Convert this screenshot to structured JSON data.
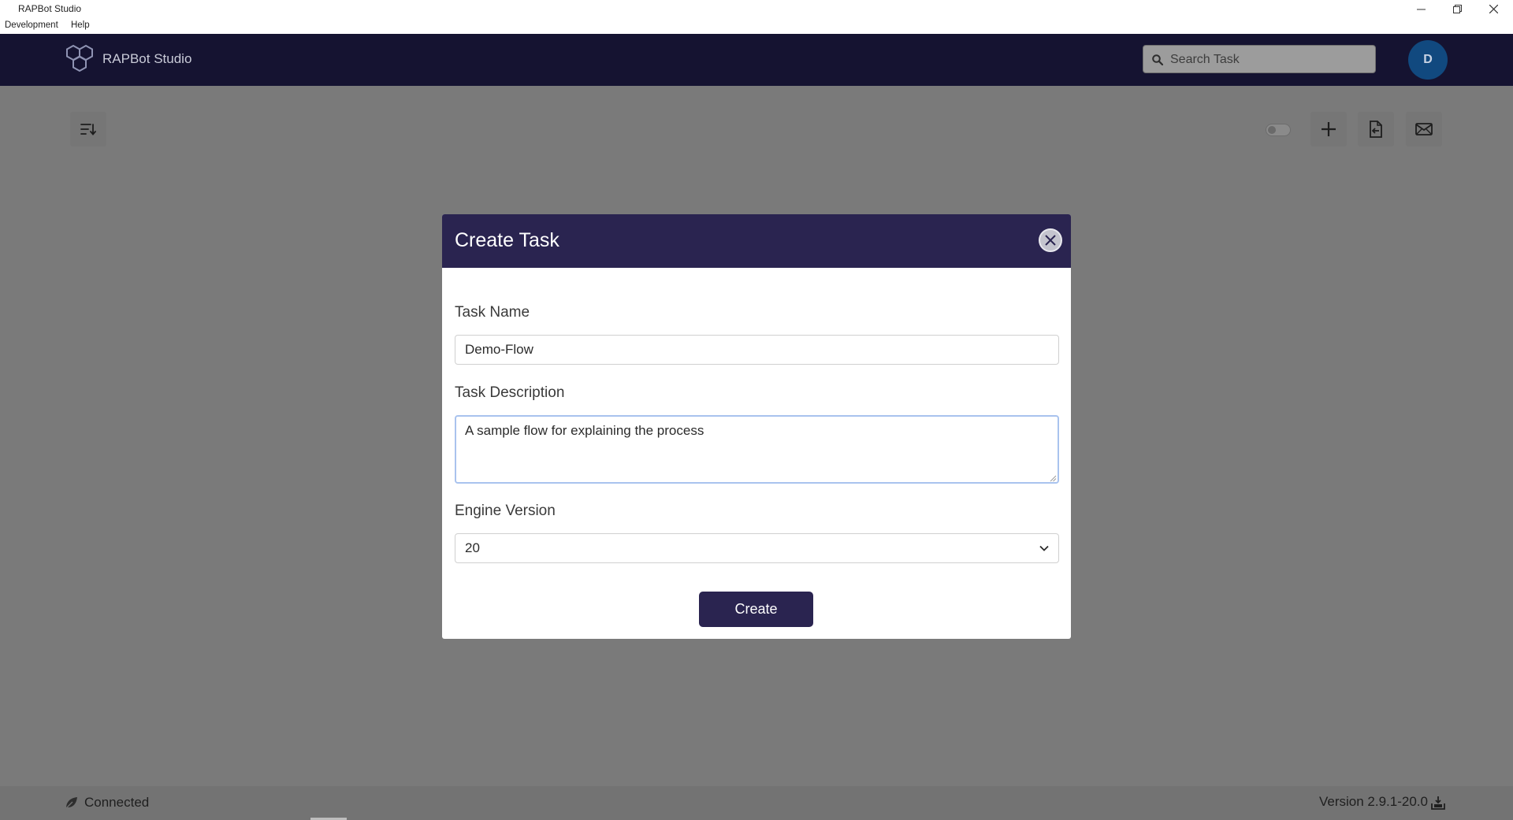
{
  "window": {
    "title": "RAPBot Studio",
    "controls": [
      "minimize-icon",
      "restore-icon",
      "close-icon"
    ]
  },
  "menu": [
    "Development",
    "Help"
  ],
  "header": {
    "brand": "RAPBot Studio",
    "search_placeholder": "Search Task",
    "avatar_initial": "D"
  },
  "toolbar": {
    "left_icon": "sort-list-icon",
    "right_icons": [
      "toggle-switch",
      "plus-icon",
      "export-file-icon",
      "mail-icon"
    ]
  },
  "modal": {
    "title": "Create Task",
    "task_name_label": "Task Name",
    "task_name_value": "Demo-Flow",
    "task_description_label": "Task Description",
    "task_description_value": "A sample flow for explaining the process",
    "engine_version_label": "Engine Version",
    "engine_version_value": "20",
    "create_label": "Create"
  },
  "status": {
    "connection": "Connected",
    "version": "Version 2.9.1-20.0"
  },
  "colors": {
    "header_bg": "#151331",
    "modal_header_bg": "#2a2450",
    "avatar_bg": "#11497f",
    "overlay": "#7a7a7a"
  }
}
